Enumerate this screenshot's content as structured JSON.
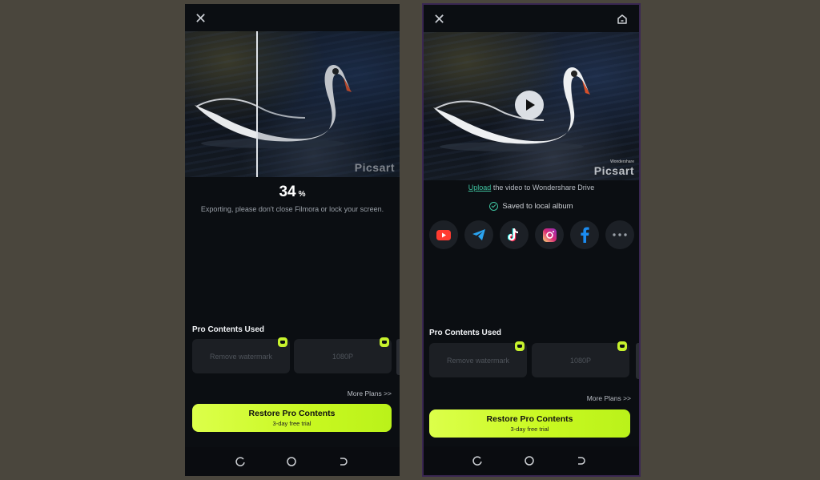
{
  "left_screen": {
    "close_icon": "close-icon",
    "export_progress_percent": 34,
    "percent_value": "34",
    "percent_sign": "%",
    "export_message": "Exporting, please don't close Filmora or lock your screen.",
    "watermark": "Picsart",
    "pro_section_title": "Pro Contents Used",
    "pro_items": [
      {
        "label": "Remove watermark",
        "badge": "crown-icon"
      },
      {
        "label": "1080P",
        "badge": "crown-icon"
      }
    ],
    "more_plans": "More Plans >>",
    "restore_button": {
      "label": "Restore Pro Contents",
      "sublabel": "3-day free trial"
    },
    "nav_icons": [
      "recents-icon",
      "home-circle-icon",
      "back-icon"
    ]
  },
  "right_screen": {
    "close_icon": "close-icon",
    "home_icon": "home-icon",
    "watermark": "Picsart",
    "watermark_small": "Wondershare",
    "play_icon": "play-icon",
    "upload_link": "Upload",
    "upload_text": " the video to Wondershare Drive",
    "saved_text": "Saved to local album",
    "share_targets": [
      {
        "name": "YouTube",
        "icon": "youtube-icon",
        "color": "#ff3b30"
      },
      {
        "name": "Telegram",
        "icon": "telegram-icon",
        "color": "#2aa3ef"
      },
      {
        "name": "TikTok",
        "icon": "tiktok-icon",
        "color": "#ffffff"
      },
      {
        "name": "Instagram",
        "icon": "instagram-icon",
        "color": "#e1306c"
      },
      {
        "name": "Facebook",
        "icon": "facebook-icon",
        "color": "#1b8cf0"
      },
      {
        "name": "More",
        "icon": "more-icon",
        "color": "#9aa0a8"
      }
    ],
    "pro_section_title": "Pro Contents Used",
    "pro_items": [
      {
        "label": "Remove watermark",
        "badge": "crown-icon"
      },
      {
        "label": "1080P",
        "badge": "crown-icon"
      }
    ],
    "more_plans": "More Plans >>",
    "restore_button": {
      "label": "Restore Pro Contents",
      "sublabel": "3-day free trial"
    },
    "nav_icons": [
      "recents-icon",
      "home-circle-icon",
      "back-icon"
    ]
  },
  "colors": {
    "accent": "#c7f22d",
    "link": "#3fc3a0",
    "background": "#0b0e12",
    "desktop": "#4a463d"
  }
}
